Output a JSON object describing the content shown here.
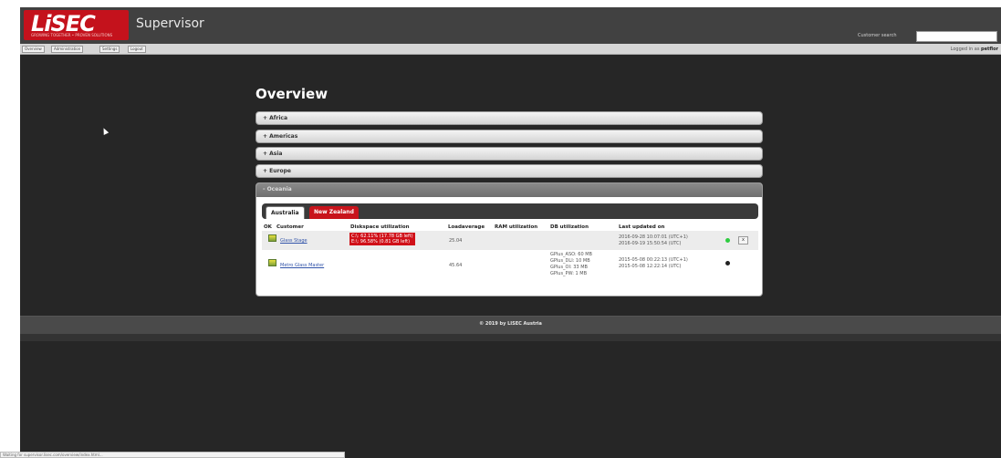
{
  "header": {
    "logo_text": "LiSEC",
    "logo_tagline": "GROWING TOGETHER • PROVEN SOLUTIONS",
    "app_title": "Supervisor",
    "customer_search_label": "Customer search",
    "customer_search_value": ""
  },
  "nav": {
    "items": [
      "Overview",
      "Administration",
      "Settings",
      "Logout"
    ],
    "logged_in_prefix": "Logged in as",
    "logged_in_user": "petflor"
  },
  "main": {
    "title": "Overview",
    "regions": [
      "+ Africa",
      "+ Americas",
      "+ Asia",
      "+ Europe"
    ],
    "expanded_region": "- Oceania",
    "tabs": [
      "Australia",
      "New Zealand"
    ],
    "columns": [
      "OK",
      "Customer",
      "Diskspace utilization",
      "Loadaverage",
      "RAM utilization",
      "DB utilization",
      "Last updated on"
    ],
    "rows": [
      {
        "customer": "Glass Stage",
        "disk": [
          "C:\\: 62.11% (17.78 GB left)",
          "E:\\: 96.58% (0.81 GB left)"
        ],
        "load": "25.04",
        "db": "",
        "updated": [
          "2016-09-28 10:07:01 (UTC+1)",
          "2016-09-19 15:50:54 (UTC)"
        ],
        "status_color": "#2ecc40",
        "action_label": "x"
      },
      {
        "customer": "Metro Glass Master",
        "disk": [],
        "load": "45.64",
        "db": [
          "GPlus_ASO: 60 MB",
          "GPlus_DLI: 10 MB",
          "GPlus_OI: 33 MB",
          "GPlus_PW: 1 MB"
        ],
        "updated": [
          "2015-05-08 00:22:13 (UTC+1)",
          "2015-05-08 12:22:14 (UTC)"
        ],
        "status_color": "#222222",
        "action_label": ""
      }
    ]
  },
  "footer": {
    "text": "© 2019 by LISEC Austria"
  },
  "status_bar": {
    "text": "Waiting for supervisor.lisec.com/overview/index.html..."
  }
}
